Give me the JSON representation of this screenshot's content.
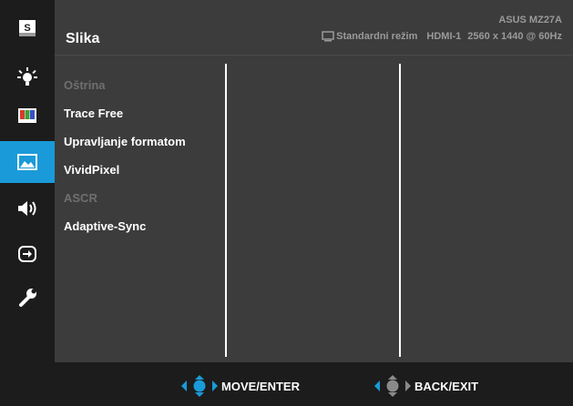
{
  "header": {
    "title": "Slika",
    "model": "ASUS MZ27A",
    "mode": "Standardni režim",
    "input": "HDMI-1",
    "resolution": "2560 x 1440 @ 60Hz"
  },
  "sidebar": {
    "active_index": 3,
    "items": [
      {
        "name": "splendid",
        "icon": "s-icon"
      },
      {
        "name": "blue-light-filter",
        "icon": "bulb-icon"
      },
      {
        "name": "color",
        "icon": "color-bars-icon"
      },
      {
        "name": "image",
        "icon": "picture-icon"
      },
      {
        "name": "sound",
        "icon": "speaker-icon"
      },
      {
        "name": "input-select",
        "icon": "input-icon"
      },
      {
        "name": "system-setup",
        "icon": "wrench-icon"
      }
    ]
  },
  "menu": {
    "items": [
      {
        "label": "Oštrina",
        "enabled": false
      },
      {
        "label": "Trace Free",
        "enabled": true
      },
      {
        "label": "Upravljanje formatom",
        "enabled": true
      },
      {
        "label": "VividPixel",
        "enabled": true
      },
      {
        "label": "ASCR",
        "enabled": false
      },
      {
        "label": "Adaptive-Sync",
        "enabled": true
      }
    ]
  },
  "footer": {
    "move_label": "MOVE/ENTER",
    "back_label": "BACK/EXIT"
  },
  "colors": {
    "accent": "#1a9ad8",
    "panel": "#3c3c3c",
    "background": "#1c1c1c",
    "disabled_text": "#6f6f6f"
  }
}
